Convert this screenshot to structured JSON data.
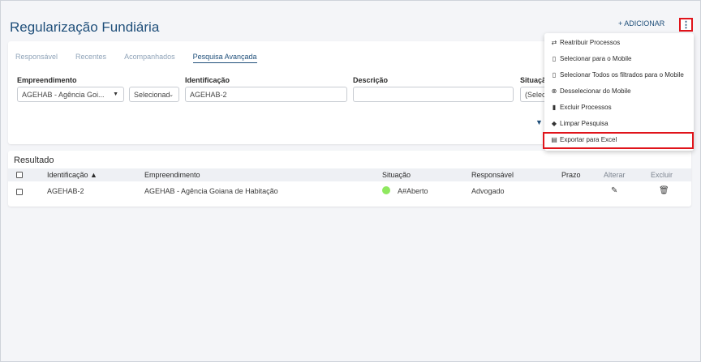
{
  "page": {
    "title": "Regularização Fundiária",
    "add_button": "+ ADICIONAR",
    "kebab_label": "⋮"
  },
  "tabs": [
    "Responsável",
    "Recentes",
    "Acompanhados",
    "Pesquisa Avançada"
  ],
  "filters": {
    "empreendimento": {
      "label": "Empreendimento",
      "value": "AGEHAB - Agência Goi..."
    },
    "selecionado": {
      "value": "Selecionad"
    },
    "identificacao": {
      "label": "Identificação",
      "value": "AGEHAB-2"
    },
    "descricao": {
      "label": "Descrição",
      "value": ""
    },
    "situacao": {
      "label": "Situaçã",
      "value": "(Selec"
    }
  },
  "results": {
    "title": "Resultado",
    "headers": {
      "identificacao": "Identificação ▲",
      "empreendimento": "Empreendimento",
      "situacao": "Situação",
      "responsavel": "Responsável",
      "prazo": "Prazo",
      "alterar": "Alterar",
      "excluir": "Excluir"
    },
    "rows": [
      {
        "identificacao": "AGEHAB-2",
        "empreendimento": "AGEHAB - Agência Goiana de Habitação",
        "situacao": "A#Aberto",
        "responsavel": "Advogado",
        "prazo": "",
        "status_color": "#8fe85f"
      }
    ]
  },
  "menu": {
    "items": [
      {
        "label": "Reatribuir Processos",
        "icon": "reassign-icon"
      },
      {
        "label": "Selecionar para o Mobile",
        "icon": "mobile-icon"
      },
      {
        "label": "Selecionar Todos os filtrados para o Mobile",
        "icon": "mobile-icon"
      },
      {
        "label": "Desselecionar do Mobile",
        "icon": "close-circle-icon"
      },
      {
        "label": "Excluir Processos",
        "icon": "trash-icon"
      },
      {
        "label": "Limpar Pesquisa",
        "icon": "eraser-icon"
      },
      {
        "label": "Exportar para Excel",
        "icon": "file-icon"
      }
    ]
  },
  "colors": {
    "accent": "#1f4f7a",
    "highlight": "#e0141b",
    "status_open": "#8fe85f"
  }
}
